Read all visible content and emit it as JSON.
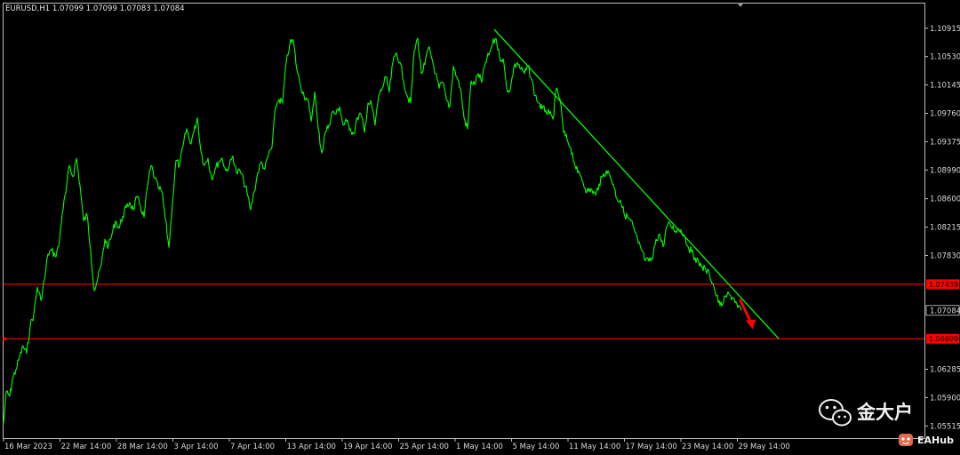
{
  "chart_data": {
    "type": "line",
    "title": "EURUSD,H1  1.07099 1.07099 1.07083 1.07084",
    "symbol": "EURUSD,H1",
    "ohlc": [
      "1.07099",
      "1.07099",
      "1.07083",
      "1.07084"
    ],
    "xlabel": "",
    "ylabel": "",
    "grid": false,
    "ylim": [
      1.0535,
      1.1125
    ],
    "y_ticks": [
      "1.10915",
      "1.10530",
      "1.10145",
      "1.09760",
      "1.09375",
      "1.08990",
      "1.08600",
      "1.08215",
      "1.07830",
      "1.07084",
      "1.06285",
      "1.05900",
      "1.05515"
    ],
    "x_ticks": [
      "16 Mar 2023",
      "22 Mar 14:00",
      "28 Mar 14:00",
      "3 Apr 14:00",
      "7 Apr 14:00",
      "13 Apr 14:00",
      "19 Apr 14:00",
      "25 Apr 14:00",
      "1 May 14:00",
      "5 May 14:00",
      "11 May 14:00",
      "17 May 14:00",
      "23 May 14:00",
      "29 May 14:00"
    ],
    "series": [
      {
        "color": "#00ff00",
        "x": [
          0,
          3,
          7,
          10,
          14,
          18,
          22,
          26,
          30,
          34,
          38,
          42,
          46,
          50,
          54,
          58,
          62,
          66,
          70,
          74,
          78,
          82,
          86,
          90,
          94,
          98,
          102,
          106,
          110,
          114,
          118,
          122,
          126,
          130,
          134,
          138,
          142,
          146,
          150,
          154,
          158,
          162,
          166,
          170,
          174,
          178,
          182,
          186,
          190,
          194,
          198,
          202,
          206,
          210,
          214,
          218,
          222,
          226,
          230,
          234,
          238,
          242,
          246,
          250,
          254,
          258,
          262,
          266,
          270,
          274,
          278,
          282,
          286,
          290,
          294,
          298,
          302,
          306,
          310,
          314,
          318,
          322,
          326,
          330,
          334,
          338,
          342,
          346,
          350,
          354,
          358,
          362,
          366,
          370,
          374,
          378,
          382,
          386,
          390,
          394,
          398,
          402,
          406,
          410,
          414,
          418,
          422,
          426,
          430,
          434,
          438,
          442,
          446,
          450,
          454,
          458,
          462,
          466,
          470,
          474,
          478,
          482,
          486,
          490,
          494,
          498,
          502,
          506,
          510,
          514,
          518,
          522,
          526,
          530,
          534,
          538,
          542,
          546,
          550,
          554,
          558,
          562,
          566,
          570,
          574,
          578,
          582,
          586,
          590,
          594,
          598,
          602,
          606,
          610,
          614,
          618,
          622,
          626,
          630,
          634,
          638,
          642,
          646,
          650,
          654,
          658,
          662,
          666,
          670,
          674,
          678,
          682,
          686,
          690,
          694,
          698,
          702,
          706,
          710,
          714,
          718,
          722,
          726,
          730,
          734,
          738,
          742,
          746,
          750,
          754,
          758,
          762,
          766,
          770,
          774,
          778,
          782,
          786,
          790,
          794,
          798,
          802,
          806,
          810,
          814,
          818,
          822,
          826,
          830
        ],
        "values": [
          1.0555,
          1.0598,
          1.0592,
          1.0615,
          1.0628,
          1.0645,
          1.066,
          1.065,
          1.0688,
          1.0703,
          1.074,
          1.0722,
          1.075,
          1.0785,
          1.079,
          1.0782,
          1.0795,
          1.084,
          1.0868,
          1.0905,
          1.089,
          1.0915,
          1.0878,
          1.083,
          1.0838,
          1.079,
          1.0735,
          1.0752,
          1.077,
          1.0805,
          1.0795,
          1.0812,
          1.083,
          1.082,
          1.0836,
          1.0848,
          1.0855,
          1.0845,
          1.0862,
          1.085,
          1.0835,
          1.0878,
          1.0905,
          1.0888,
          1.0875,
          1.087,
          1.0833,
          1.0794,
          1.0855,
          1.0912,
          1.0905,
          1.0932,
          1.0955,
          1.0935,
          1.095,
          1.097,
          1.0925,
          1.0905,
          1.0915,
          1.0888,
          1.09,
          1.091,
          1.0915,
          1.0898,
          1.0905,
          1.0918,
          1.0895,
          1.0898,
          1.0885,
          1.0868,
          1.0845,
          1.087,
          1.0895,
          1.091,
          1.09,
          1.092,
          1.093,
          1.0985,
          1.0995,
          1.099,
          1.1045,
          1.107,
          1.1075,
          1.1035,
          1.1015,
          1.1,
          1.0995,
          1.0965,
          1.1005,
          1.0955,
          1.0922,
          1.095,
          1.096,
          1.0978,
          1.0975,
          1.0985,
          1.096,
          1.0965,
          1.0955,
          1.0948,
          1.097,
          1.0975,
          1.095,
          1.099,
          1.0988,
          1.096,
          1.1,
          1.101,
          1.1025,
          1.1005,
          1.1045,
          1.1058,
          1.1045,
          1.102,
          1.1,
          1.099,
          1.106,
          1.1078,
          1.103,
          1.1042,
          1.1065,
          1.105,
          1.103,
          1.101,
          1.1018,
          1.0995,
          1.0985,
          1.104,
          1.1025,
          1.101,
          1.097,
          1.0955,
          1.102,
          1.1015,
          1.103,
          1.1018,
          1.1045,
          1.1055,
          1.107,
          1.1078,
          1.1052,
          1.105,
          1.101,
          1.1008,
          1.1038,
          1.1045,
          1.1036,
          1.103,
          1.104,
          1.1022,
          1.1,
          1.099,
          1.0982,
          1.098,
          1.0975,
          1.0968,
          1.101,
          1.0995,
          1.095,
          1.094,
          1.093,
          1.091,
          1.0895,
          1.089,
          1.0875,
          1.087,
          1.0872,
          1.0865,
          1.088,
          1.089,
          1.0898,
          1.0892,
          1.088,
          1.086,
          1.0858,
          1.084,
          1.0835,
          1.083,
          1.0815,
          1.08,
          1.079,
          1.0776,
          1.0775,
          1.0778,
          1.0805,
          1.0812,
          1.0795,
          1.0822,
          1.0825,
          1.0818,
          1.0818,
          1.0818,
          1.081,
          1.0795,
          1.0788,
          1.078,
          1.0773,
          1.0768,
          1.0763,
          1.0758,
          1.0745,
          1.0728,
          1.0715,
          1.072,
          1.073,
          1.0728,
          1.0725,
          1.0712,
          1.0708
        ]
      }
    ],
    "trendline": {
      "color": "#00ff00",
      "from": [
        556,
        1.109
      ],
      "to": [
        876,
        1.067
      ]
    },
    "levels": [
      {
        "value": 1.07439,
        "label": "1.07439",
        "color": "#ff0000"
      },
      {
        "value": 1.06699,
        "label": "1.06699",
        "color": "#ff0000"
      }
    ],
    "current_price_label": "1.07084",
    "arrow": {
      "color": "#ff0000",
      "from": [
        833,
        1.0722
      ],
      "to": [
        846,
        1.0685
      ]
    }
  },
  "watermark": {
    "icon": "wechat-icon",
    "text": "金大户",
    "sub_icon": "eahub-icon",
    "sub_text": "EAHub"
  },
  "colors": {
    "background": "#000000",
    "foreground": "#e6e6e6",
    "price_line": "#00ff00",
    "level_line": "#ff0000"
  }
}
